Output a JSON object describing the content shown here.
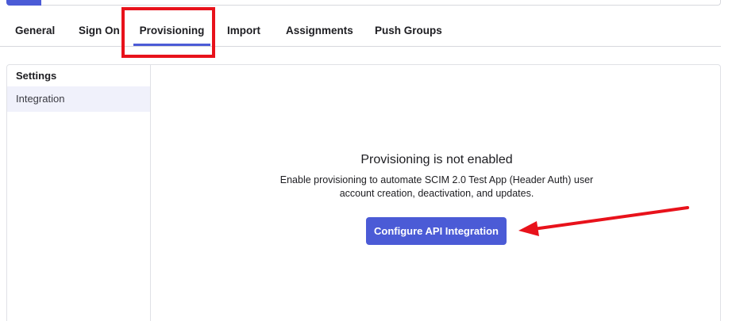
{
  "tabs": [
    {
      "label": "General"
    },
    {
      "label": "Sign On"
    },
    {
      "label": "Provisioning",
      "active": true
    },
    {
      "label": "Import"
    },
    {
      "label": "Assignments"
    },
    {
      "label": "Push Groups"
    }
  ],
  "sidebar": {
    "heading": "Settings",
    "items": [
      {
        "label": "Integration",
        "selected": true
      }
    ]
  },
  "main": {
    "title": "Provisioning is not enabled",
    "description": "Enable provisioning to automate SCIM 2.0 Test App (Header Auth) user account creation, deactivation, and updates.",
    "button_label": "Configure API Integration"
  },
  "colors": {
    "accent": "#4b5bd6",
    "annotation_red": "#e8121b"
  }
}
